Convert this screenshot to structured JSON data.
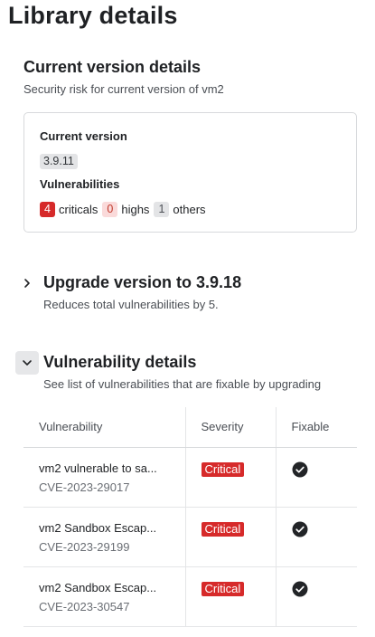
{
  "page": {
    "title": "Library details"
  },
  "current_version_section": {
    "title": "Current version details",
    "subtitle": "Security risk for current version of vm2",
    "card": {
      "version_label": "Current version",
      "version_value": "3.9.11",
      "vulnerabilities_label": "Vulnerabilities",
      "counts": [
        {
          "value": "4",
          "label": "criticals"
        },
        {
          "value": "0",
          "label": "highs"
        },
        {
          "value": "1",
          "label": "others"
        }
      ]
    }
  },
  "upgrade_section": {
    "title": "Upgrade version to 3.9.18",
    "subtitle": "Reduces total vulnerabilities by 5.",
    "icon": "chevron-right-icon"
  },
  "vuln_section": {
    "title": "Vulnerability details",
    "subtitle": "See list of vulnerabilities that are fixable by upgrading",
    "icon": "chevron-down-icon",
    "table": {
      "headers": [
        "Vulnerability",
        "Severity",
        "Fixable"
      ],
      "rows": [
        {
          "name": "vm2 vulnerable to sa...",
          "cve": "CVE-2023-29017",
          "severity": "Critical",
          "fixable": "check-circle-icon"
        },
        {
          "name": "vm2 Sandbox Escap...",
          "cve": "CVE-2023-29199",
          "severity": "Critical",
          "fixable": "check-circle-icon"
        },
        {
          "name": "vm2 Sandbox Escap...",
          "cve": "CVE-2023-30547",
          "severity": "Critical",
          "fixable": "check-circle-icon"
        }
      ]
    }
  },
  "colors": {
    "critical": "#d62a2a",
    "high_bg": "#fadada",
    "neutral_chip": "#e3e4e6",
    "text": "#1f2124"
  }
}
